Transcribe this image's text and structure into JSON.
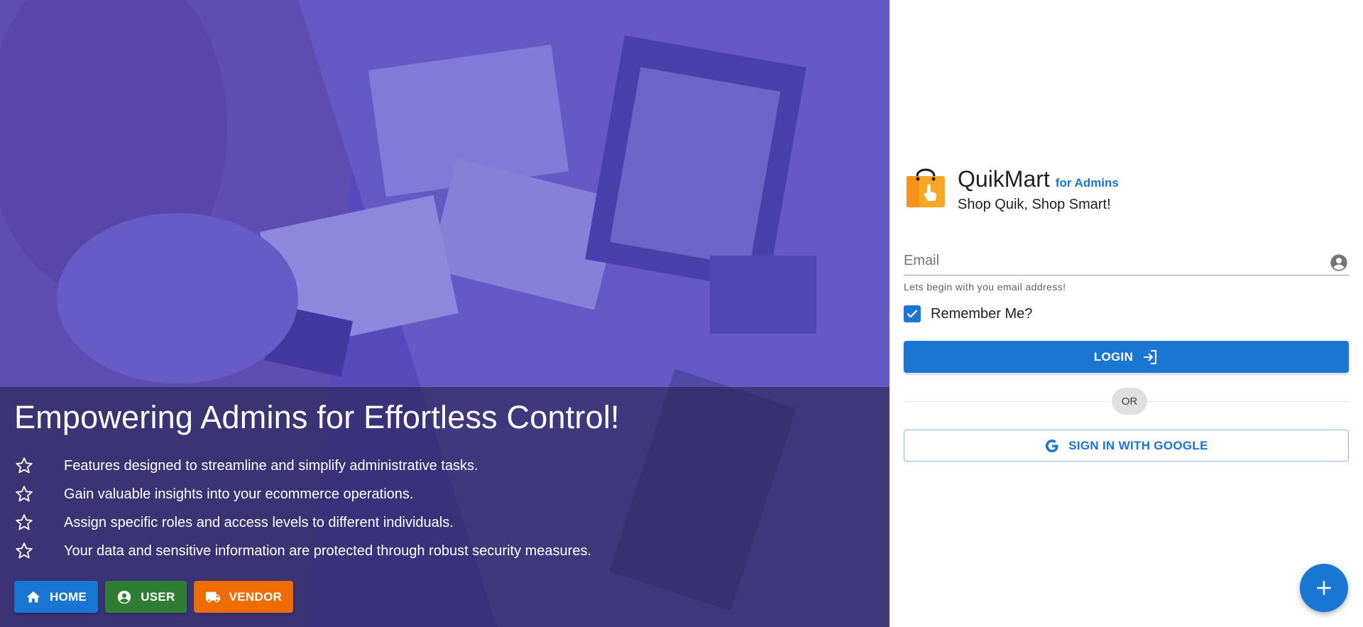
{
  "hero": {
    "title": "Empowering Admins for Effortless Control!",
    "features": [
      {
        "icon": "star-outline-icon",
        "text": "Features designed to streamline and simplify administrative tasks."
      },
      {
        "icon": "star-outline-icon",
        "text": "Gain valuable insights into your ecommerce operations."
      },
      {
        "icon": "star-outline-icon",
        "text": "Assign specific roles and access levels to different individuals."
      },
      {
        "icon": "star-outline-icon",
        "text": "Your data and sensitive information are protected through robust security measures."
      }
    ],
    "buttons": {
      "home": {
        "label": "HOME",
        "icon": "home-icon",
        "color": "#1976d2"
      },
      "user": {
        "label": "USER",
        "icon": "account-circle-icon",
        "color": "#2e7d32"
      },
      "vendor": {
        "label": "VENDOR",
        "icon": "truck-icon",
        "color": "#ef6c00"
      }
    }
  },
  "brand": {
    "name": "QuikMart",
    "subtitle": "for Admins",
    "tagline": "Shop Quik, Shop Smart!",
    "logo_icon": "shopping-bag-icon"
  },
  "login_form": {
    "email": {
      "placeholder": "Email",
      "value": "",
      "hint": "Lets begin with you email address!"
    },
    "remember": {
      "label": "Remember Me?",
      "checked": true
    },
    "login_label": "LOGIN",
    "divider_label": "OR",
    "google_label": "SIGN IN WITH GOOGLE"
  },
  "colors": {
    "primary": "#1976d2",
    "success": "#2e7d32",
    "warning": "#ef6c00",
    "hero_tint": "#483cc8"
  }
}
